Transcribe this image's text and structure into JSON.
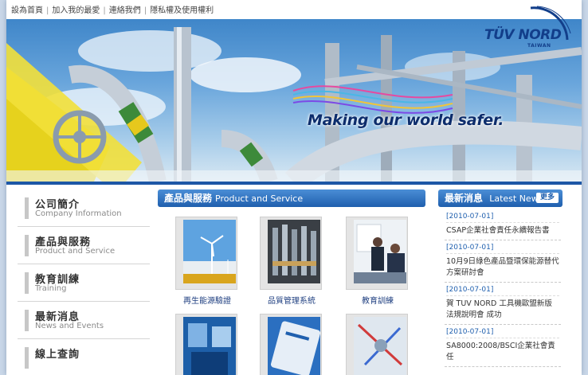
{
  "top_links": [
    "設為首頁",
    "加入我的最愛",
    "連絡我們",
    "隱私權及使用權利"
  ],
  "logo": {
    "name": "TÜV NORD",
    "sub": "TAIWAN"
  },
  "banner": {
    "slogan": "Making our world safer."
  },
  "nav": [
    {
      "zh": "公司簡介",
      "en": "Company Information"
    },
    {
      "zh": "產品與服務",
      "en": "Product and Service"
    },
    {
      "zh": "教育訓練",
      "en": "Training"
    },
    {
      "zh": "最新消息",
      "en": "News and Events"
    },
    {
      "zh": "線上查詢",
      "en": ""
    }
  ],
  "products": {
    "title_zh": "產品與服務",
    "title_en": "Product and Service",
    "items": [
      {
        "label": "再生能源驗證",
        "icon": "wind-turbine"
      },
      {
        "label": "品質管理系統",
        "icon": "test-tubes"
      },
      {
        "label": "教育訓練",
        "icon": "business-meeting"
      },
      {
        "label": "",
        "icon": "measuring-gauge"
      },
      {
        "label": "",
        "icon": "tablet-screen"
      },
      {
        "label": "",
        "icon": "lab-apparatus"
      }
    ]
  },
  "news": {
    "title_zh": "最新消息",
    "title_en": "Latest News",
    "more": "更多",
    "items": [
      {
        "date": "[2010-07-01]",
        "title": "CSAP企業社會責任永續報告書"
      },
      {
        "date": "[2010-07-01]",
        "title": "10月9日綠色產品暨環保能源替代方案研討會"
      },
      {
        "date": "[2010-07-01]",
        "title": "賀 TUV NORD 工具機歐盟新版法規說明會 成功"
      },
      {
        "date": "[2010-07-01]",
        "title": "SA8000:2008/BSCI企業社會責任"
      }
    ]
  },
  "colors": {
    "brand": "#123e8a",
    "header_blue": "#1f5fae",
    "link": "#1f3f80"
  }
}
